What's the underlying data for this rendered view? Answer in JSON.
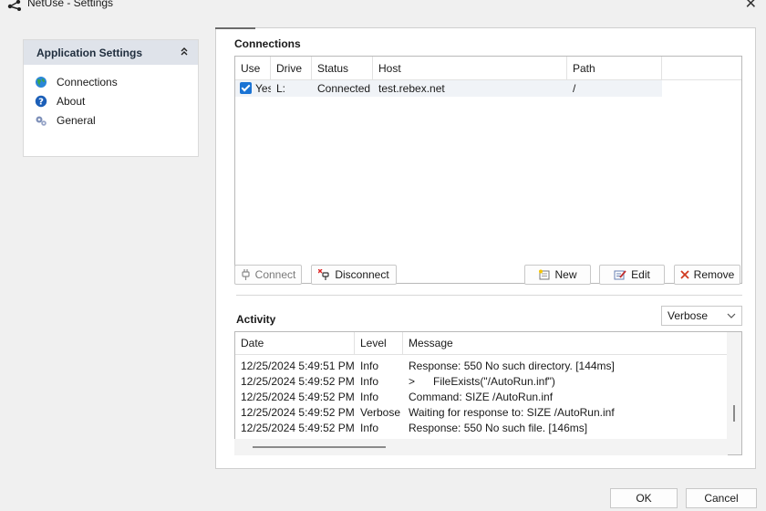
{
  "window": {
    "title": "NetUse - Settings",
    "close_glyph": "✕",
    "icon": "share-icon"
  },
  "nav": {
    "header": "Application Settings",
    "collapse_glyph": "⌃",
    "items": [
      {
        "label": "Connections",
        "icon": "globe-icon"
      },
      {
        "label": "About",
        "icon": "help-icon"
      },
      {
        "label": "General",
        "icon": "gears-icon"
      }
    ]
  },
  "connections": {
    "title": "Connections",
    "columns": [
      "Use",
      "Drive",
      "Status",
      "Host",
      "Path"
    ],
    "rows": [
      {
        "use": "Yes",
        "checked": true,
        "drive": "L:",
        "status": "Connected",
        "host": "test.rebex.net",
        "path": "/"
      }
    ],
    "buttons": {
      "connect": "Connect",
      "disconnect": "Disconnect",
      "new": "New",
      "edit": "Edit",
      "remove": "Remove"
    }
  },
  "activity": {
    "title": "Activity",
    "level_filter": "Verbose",
    "columns": [
      "Date",
      "Level",
      "Message"
    ],
    "rows": [
      {
        "date": "12/25/2024 5:49:51 PM",
        "level": "Info",
        "message": "Response: 550 No such directory. [144ms]"
      },
      {
        "date": "12/25/2024 5:49:52 PM",
        "level": "Info",
        "message": ">      FileExists(\"/AutoRun.inf\")"
      },
      {
        "date": "12/25/2024 5:49:52 PM",
        "level": "Info",
        "message": "Command: SIZE /AutoRun.inf"
      },
      {
        "date": "12/25/2024 5:49:52 PM",
        "level": "Verbose",
        "message": "Waiting for response to: SIZE /AutoRun.inf"
      },
      {
        "date": "12/25/2024 5:49:52 PM",
        "level": "Info",
        "message": "Response: 550 No such file. [146ms]"
      }
    ]
  },
  "footer": {
    "ok": "OK",
    "cancel": "Cancel"
  },
  "colors": {
    "accent": "#1a73d4",
    "header_bg": "#dfe3ea"
  }
}
